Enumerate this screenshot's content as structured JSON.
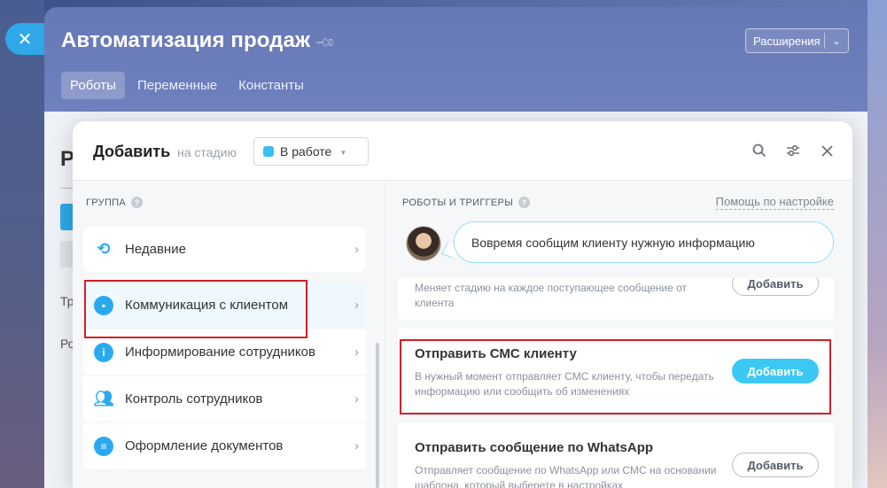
{
  "slider": {
    "title": "Автоматизация продаж",
    "extensions_label": "Расширения",
    "tabs": [
      {
        "label": "Роботы",
        "active": true
      },
      {
        "label": "Переменные",
        "active": false
      },
      {
        "label": "Константы",
        "active": false
      }
    ],
    "close_icon": "close-icon"
  },
  "behind": {
    "heading_fragment": "Р",
    "text_1": "Тр",
    "text_2": "Ро"
  },
  "modal": {
    "title": "Добавить",
    "stage_label": "на стадию",
    "stage_value": "В работе",
    "stage_color": "#39c0ef",
    "icons": [
      "search-icon",
      "settings-sliders-icon",
      "close-icon"
    ]
  },
  "groups": {
    "header": "ГРУППА",
    "items": [
      {
        "label": "Недавние",
        "icon": "history-icon"
      },
      {
        "label": "Коммуникация с клиентом",
        "icon": "chat-icon",
        "active": true
      },
      {
        "label": "Информирование сотрудников",
        "icon": "info-icon"
      },
      {
        "label": "Контроль сотрудников",
        "icon": "users-icon"
      },
      {
        "label": "Оформление документов",
        "icon": "document-icon"
      }
    ]
  },
  "robots": {
    "header": "РОБОТЫ И ТРИГГЕРЫ",
    "help_link": "Помощь по настройке",
    "tip": "Вовремя сообщим клиенту нужную информацию",
    "cards": [
      {
        "title": "",
        "desc": "Меняет стадию на каждое поступающее сообщение от клиента",
        "button": "Добавить"
      },
      {
        "title": "Отправить СМС клиенту",
        "desc": "В нужный момент отправляет СМС клиенту, чтобы передать информацию или сообщить об изменениях",
        "button": "Добавить"
      },
      {
        "title": "Отправить сообщение по WhatsApp",
        "desc": "Отправляет сообщение по WhatsApp или СМС на основании шаблона, который выберете в настройках",
        "button": "Добавить"
      }
    ]
  },
  "colors": {
    "accent": "#3bc8f5",
    "highlight": "#d21f2a"
  }
}
